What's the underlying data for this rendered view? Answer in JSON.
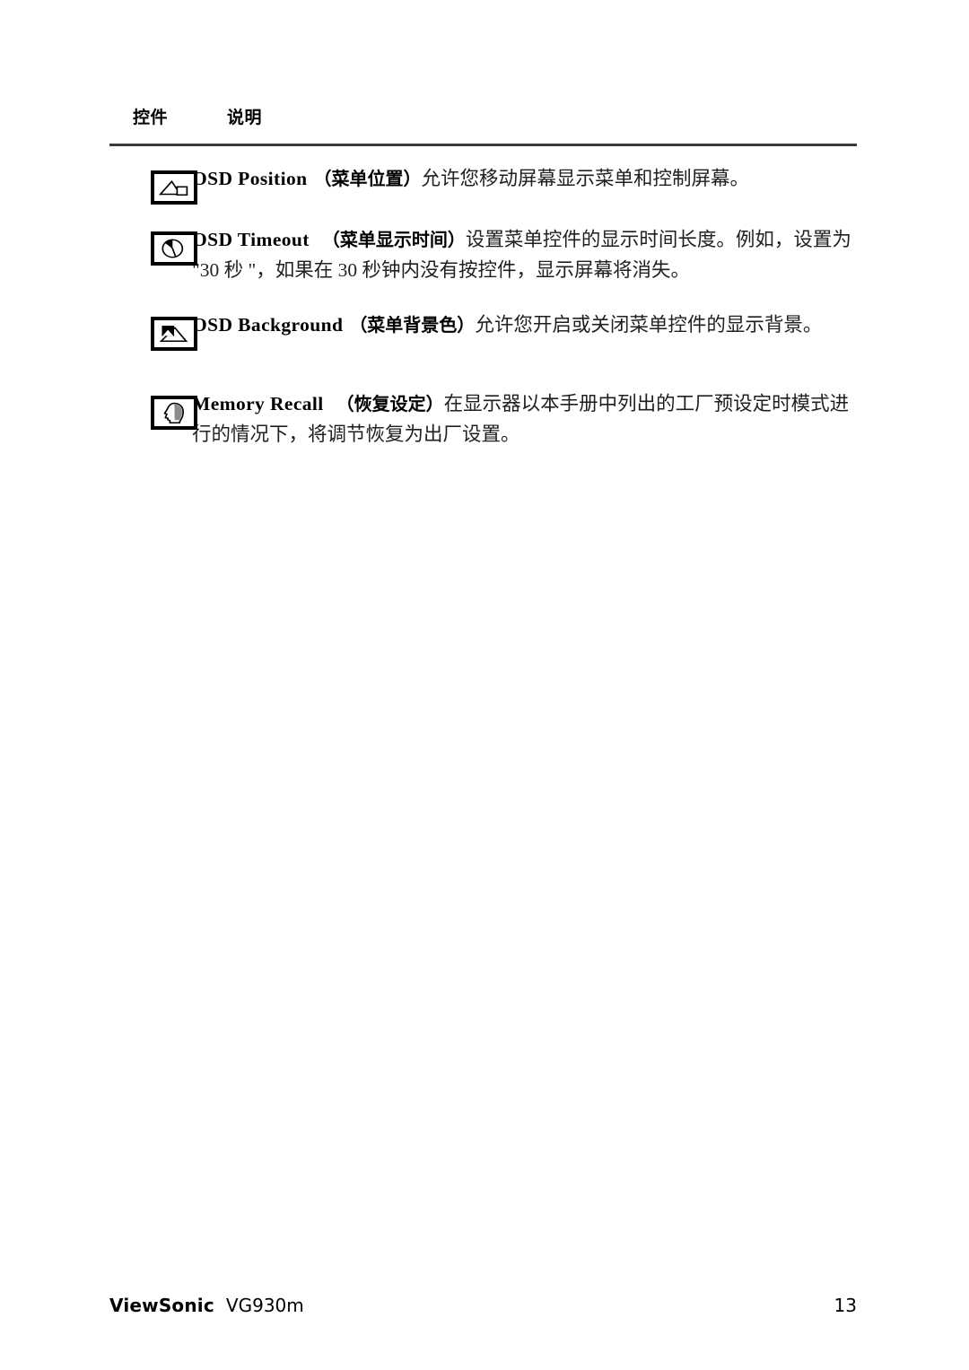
{
  "document": {
    "table": {
      "headers": {
        "control": "控件",
        "description": "说明"
      },
      "rows": [
        {
          "icon": "osd-position-icon",
          "term_en": "OSD Position",
          "term_cn": "（菜单位置）",
          "body": "允许您移动屏幕显示菜单和控制屏幕。"
        },
        {
          "icon": "osd-timeout-clock-icon",
          "term_en": "OSD Timeout",
          "term_cn": "（菜单显示时间）",
          "body": "设置菜单控件的显示时间长度。例如，设置为 \"30 秒 \"，如果在 30 秒钟内没有按控件，显示屏幕将消失。"
        },
        {
          "icon": "osd-background-icon",
          "term_en": "OSD Background",
          "term_cn": "（菜单背景色）",
          "body": "允许您开启或关闭菜单控件的显示背景。"
        },
        {
          "icon": "memory-recall-head-icon",
          "term_en": "Memory Recall",
          "term_cn": "（恢复设定）",
          "body": "在显示器以本手册中列出的工厂预设定时模式进行的情况下，将调节恢复为出厂设置。"
        }
      ]
    },
    "footer": {
      "brand": "ViewSonic",
      "model": "VG930m",
      "page_number": "13"
    },
    "colors": {
      "text": "#000000",
      "body_text": "#1f1f1f",
      "rule": "#3a3a3a",
      "icon_stroke": "#000000",
      "icon_fill": "#8c8c8c",
      "background": "#ffffff"
    }
  }
}
